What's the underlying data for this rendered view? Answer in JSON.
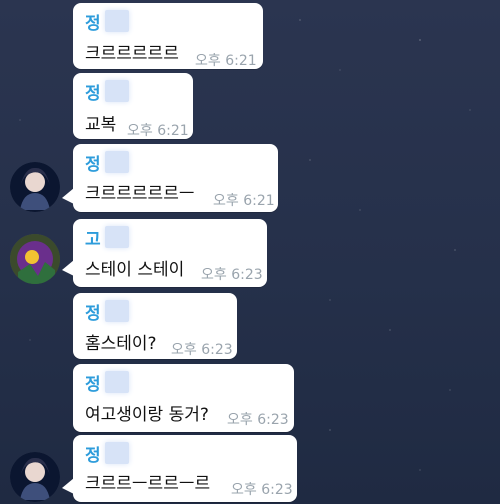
{
  "messages": [
    {
      "sender": "정",
      "text": "크르르르르르",
      "time": "오후 6:21"
    },
    {
      "sender": "정",
      "text": "교복",
      "time": "오후 6:21"
    },
    {
      "sender": "정",
      "text": "크르르르르르ㅡ",
      "time": "오후 6:21"
    },
    {
      "sender": "고",
      "text": "스테이 스테이",
      "time": "오후 6:23"
    },
    {
      "sender": "정",
      "text": "홈스테이?",
      "time": "오후 6:23"
    },
    {
      "sender": "정",
      "text": "여고생이랑 동거?",
      "time": "오후 6:23"
    },
    {
      "sender": "정",
      "text": "크르르ㅡ르르ㅡ르",
      "time": "오후 6:23"
    }
  ]
}
